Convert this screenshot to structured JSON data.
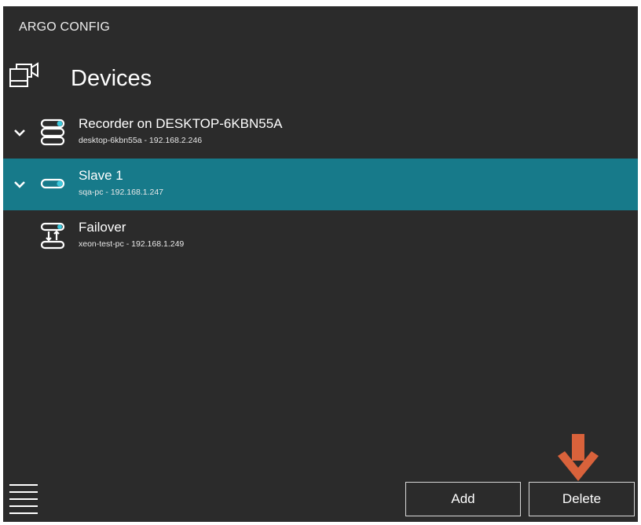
{
  "app": {
    "title": "ARGO CONFIG"
  },
  "header": {
    "icon": "camera-monitor-icon",
    "title": "Devices"
  },
  "devices": [
    {
      "name": "Recorder on DESKTOP-6KBN55A",
      "subtitle": "desktop-6kbn55a - 192.168.2.246",
      "icon": "recorder-server-icon",
      "expanded": true,
      "selected": false
    },
    {
      "name": "Slave 1",
      "subtitle": "sqa-pc - 192.168.1.247",
      "icon": "slave-server-icon",
      "expanded": true,
      "selected": true
    },
    {
      "name": "Failover",
      "subtitle": "xeon-test-pc - 192.168.1.249",
      "icon": "failover-server-icon",
      "expanded": false,
      "selected": false
    }
  ],
  "footer": {
    "menu_icon": "list-menu-icon",
    "add_label": "Add",
    "delete_label": "Delete",
    "arrow_icon": "down-arrow-icon"
  },
  "colors": {
    "background": "#2b2b2b",
    "selected_row": "#177a8a",
    "status_dot": "#3cc8dc",
    "arrow": "#d9623b",
    "text": "#ffffff"
  }
}
